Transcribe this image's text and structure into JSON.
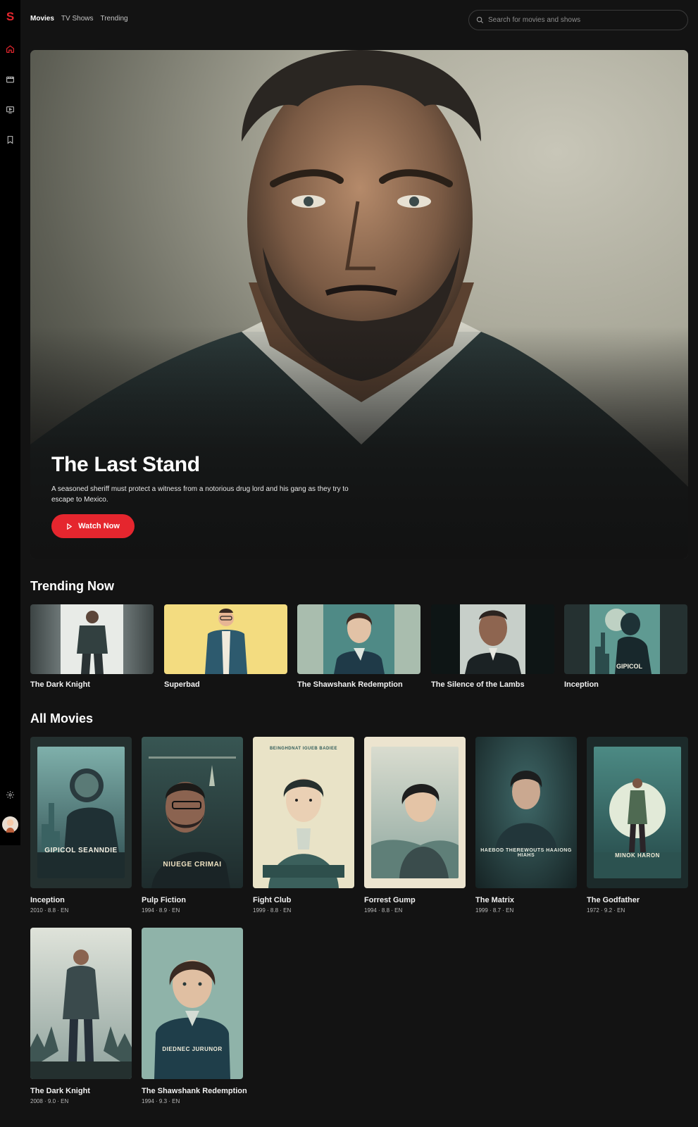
{
  "app": {
    "logo": "S"
  },
  "nav": {
    "tabs": [
      "Movies",
      "TV Shows",
      "Trending"
    ]
  },
  "search": {
    "placeholder": "Search for movies and shows"
  },
  "hero": {
    "title": "The Last Stand",
    "description": "A seasoned sheriff must protect a witness from a notorious drug lord and his gang as they try to escape to Mexico.",
    "cta": "Watch Now"
  },
  "trending": {
    "title": "Trending Now",
    "items": [
      {
        "title": "The Dark Knight"
      },
      {
        "title": "Superbad"
      },
      {
        "title": "The Shawshank Redemption"
      },
      {
        "title": "The Silence of the Lambs"
      },
      {
        "title": "Inception"
      }
    ]
  },
  "all_movies": {
    "title": "All Movies",
    "items": [
      {
        "title": "Inception",
        "meta": "2010 · 8.8 · EN",
        "poster_text": "GIPICOL SEANNDIE"
      },
      {
        "title": "Pulp Fiction",
        "meta": "1994 · 8.9 · EN",
        "poster_text": "NIUEGE CRIMAI"
      },
      {
        "title": "Fight Club",
        "meta": "1999 · 8.8 · EN",
        "poster_text": "BEINGHDNAT IGUEB BADIEE"
      },
      {
        "title": "Forrest Gump",
        "meta": "1994 · 8.8 · EN",
        "poster_text": ""
      },
      {
        "title": "The Matrix",
        "meta": "1999 · 8.7 · EN",
        "poster_text": "HAEBOD THEREWOUTS HAAIONG HIAHS"
      },
      {
        "title": "The Godfather",
        "meta": "1972 · 9.2 · EN",
        "poster_text": "MINOK HARON"
      },
      {
        "title": "The Dark Knight",
        "meta": "2008 · 9.0 · EN",
        "poster_text": ""
      },
      {
        "title": "The Shawshank Redemption",
        "meta": "1994 · 9.3 · EN",
        "poster_text": "DIEDNEC JURUNOR"
      }
    ]
  },
  "colors": {
    "accent": "#e5262e",
    "background": "#131313",
    "sidebar": "#000000"
  }
}
